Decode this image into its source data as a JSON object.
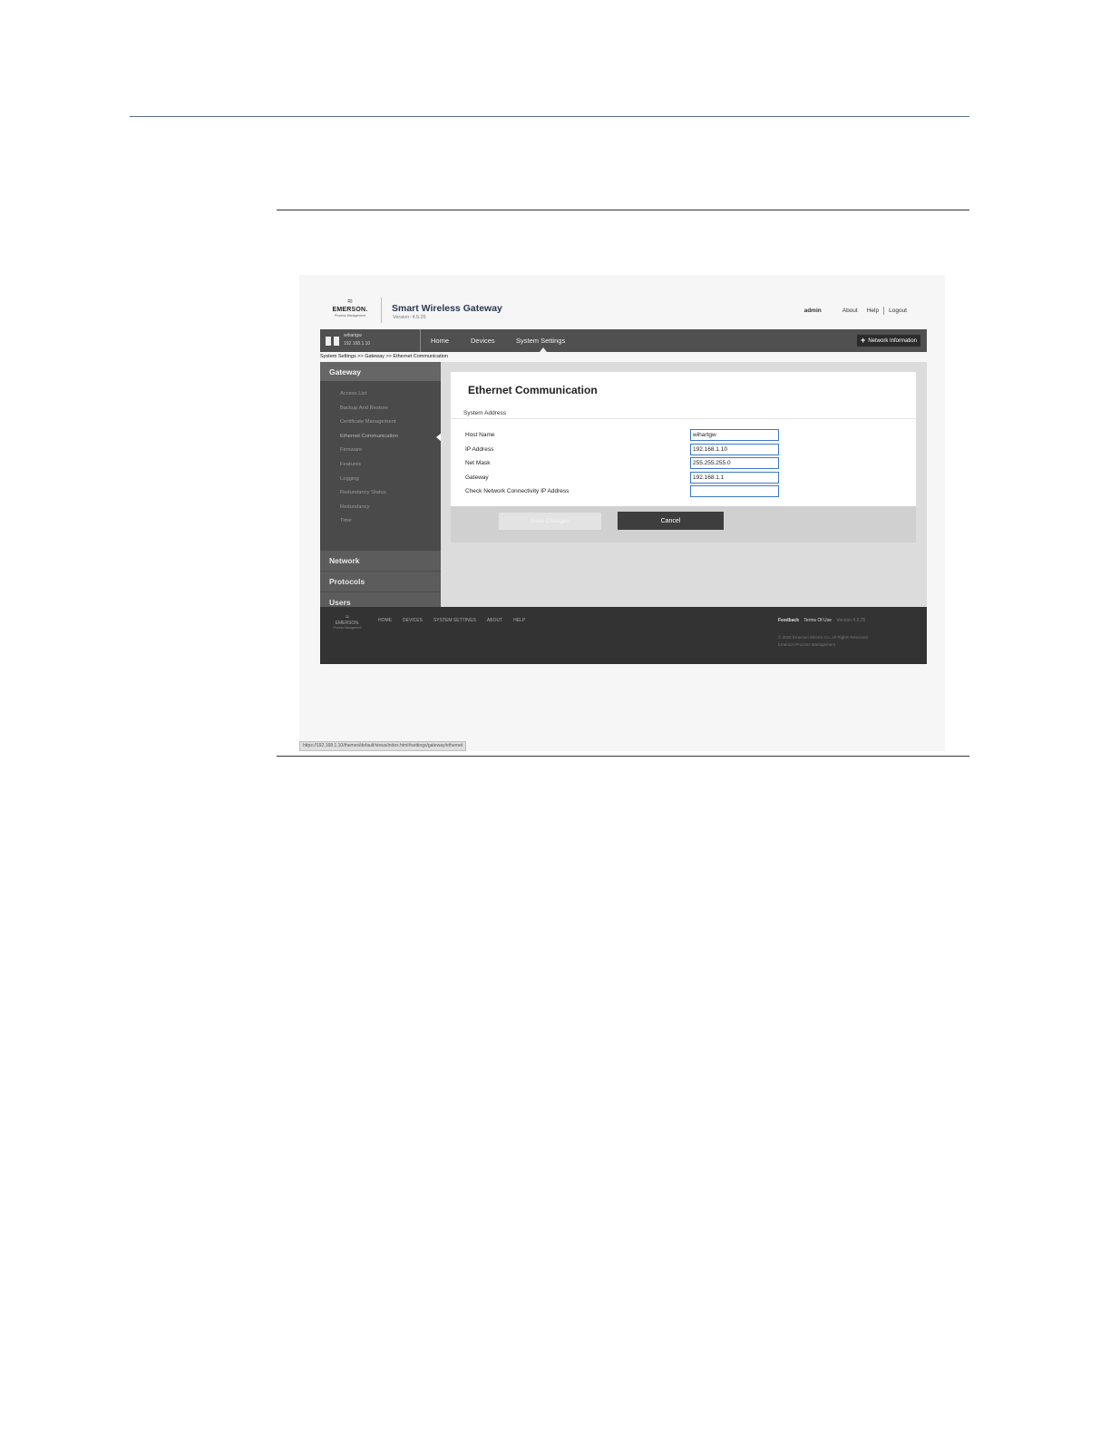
{
  "header": {
    "logo_word": "EMERSON.",
    "logo_sub": "Process Management",
    "app_title": "Smart Wireless Gateway",
    "version": "Version: 4.5.25",
    "user": "admin",
    "links": [
      "About",
      "Help",
      "Logout"
    ]
  },
  "nav": {
    "device_name": "wihartgw",
    "device_ip": "192.168.1.10",
    "tabs": [
      "Home",
      "Devices",
      "System Settings"
    ],
    "active_tab": "System Settings",
    "network_info_label": "Network Information"
  },
  "breadcrumb": "System Settings >> Gateway >> Ethernet Communication",
  "sidebar": {
    "gateway_label": "Gateway",
    "items": [
      "Access List",
      "Backup And Restore",
      "Certificate Management",
      "Ethernet Communication",
      "Firmware",
      "Features",
      "Logging",
      "Redundancy Status",
      "Redundancy",
      "Time"
    ],
    "active_item": "Ethernet Communication",
    "sections": [
      "Network",
      "Protocols",
      "Users"
    ]
  },
  "form": {
    "title": "Ethernet Communication",
    "subtitle": "System Address",
    "fields": [
      {
        "label": "Host Name",
        "value": "wihartgw"
      },
      {
        "label": "IP Address",
        "value": "192.168.1.10"
      },
      {
        "label": "Net Mask",
        "value": "255.255.255.0"
      },
      {
        "label": "Gateway",
        "value": "192.168.1.1"
      },
      {
        "label": "Check Network Connectivity IP Address",
        "value": ""
      }
    ],
    "save_label": "Save Changes",
    "cancel_label": "Cancel"
  },
  "footer": {
    "logo_word": "EMERSON.",
    "logo_sub": "Process Management",
    "links": [
      "HOME",
      "DEVICES",
      "SYSTEM SETTINGS",
      "ABOUT",
      "HELP"
    ],
    "feedback": "Feedback",
    "terms": "Terms Of Use",
    "version": "Version 4.5.25",
    "copyright": "© 2015 Emerson Electric Co. All Rights Reserved.",
    "copyright2": "Emerson Process Management"
  },
  "status_url": "https://192.168.1.10/themes/default/views/index.html#settings/gateway/ethernet",
  "colors": {
    "nav_bg": "#505050",
    "sidebar_bg": "#4a4a4a",
    "footer_bg": "#333333",
    "input_border": "#3a78c8",
    "cancel_bg": "#3e3e3e"
  }
}
